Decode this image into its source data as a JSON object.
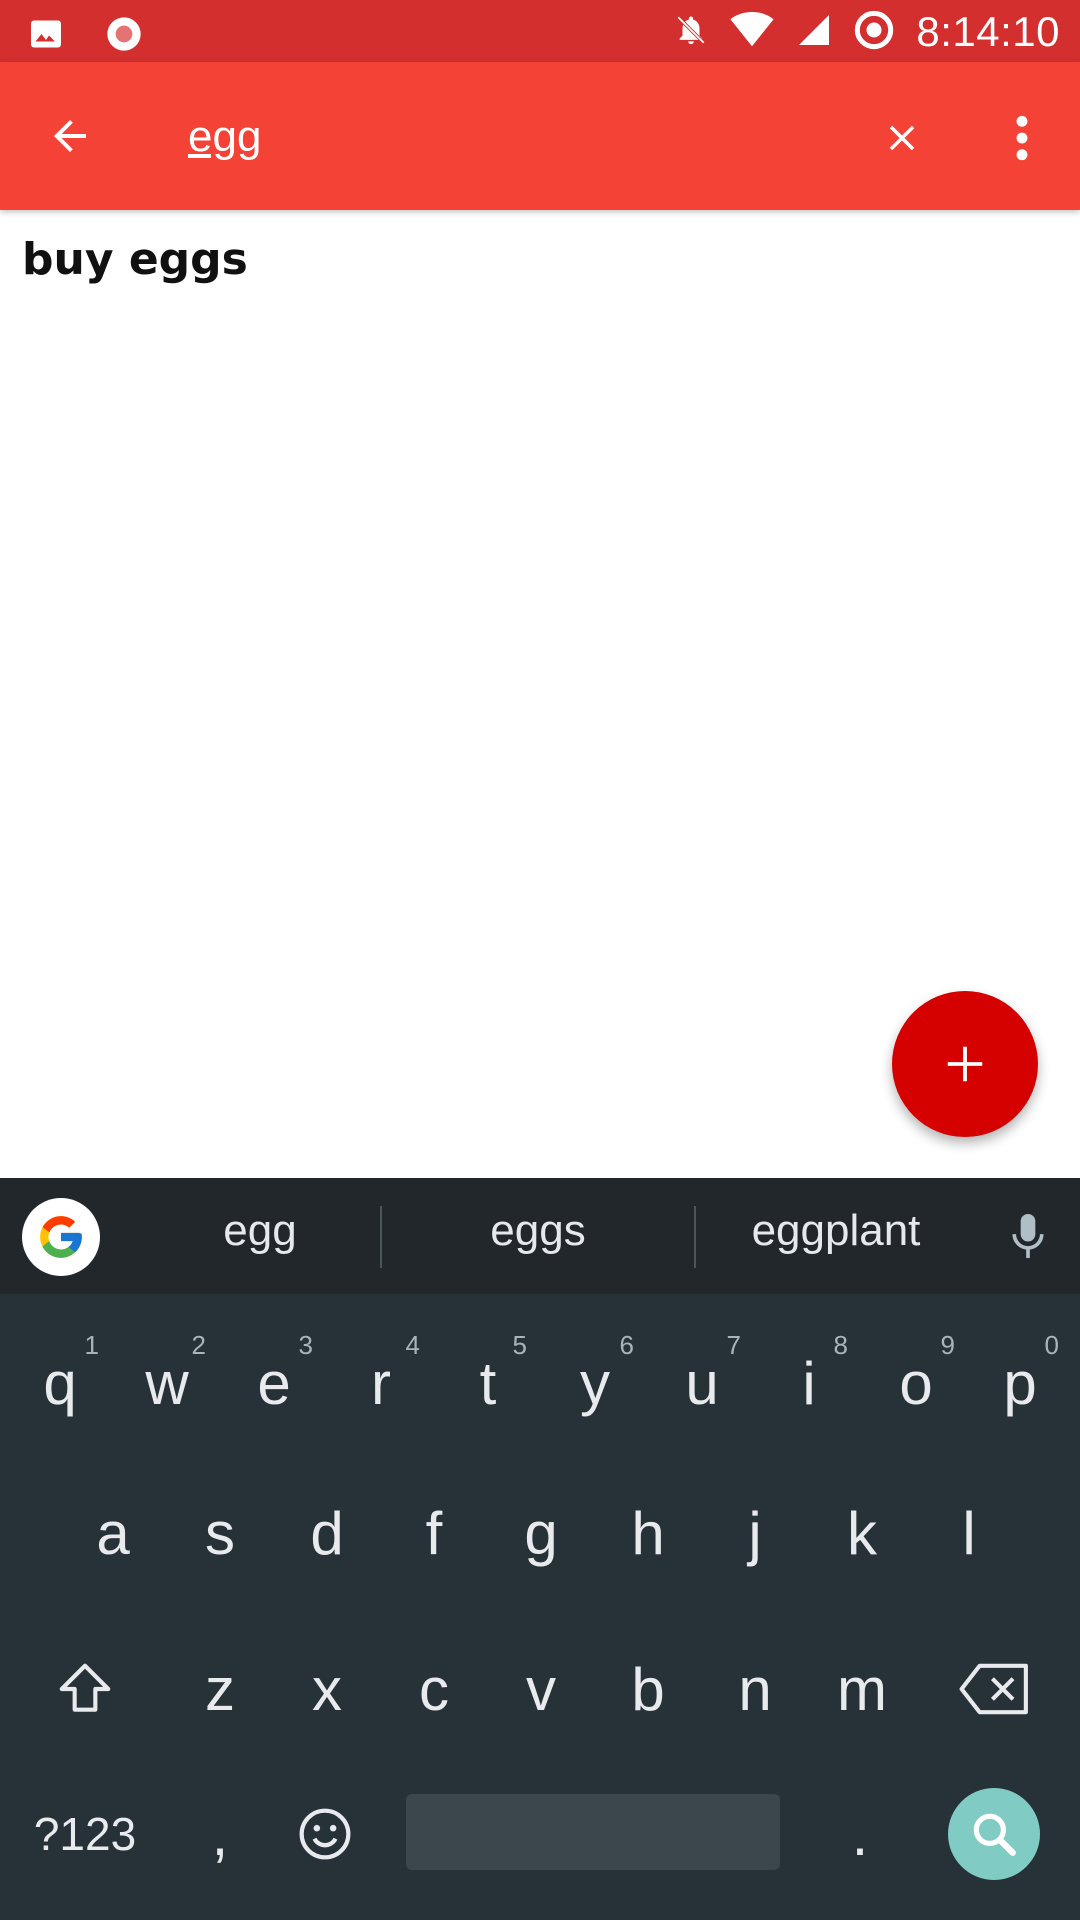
{
  "status_bar": {
    "time": "8:14:10",
    "icons": [
      "image-icon",
      "record-icon",
      "notifications-off-icon",
      "wifi-icon",
      "signal-icon",
      "sync-icon"
    ],
    "bg_color": "#d32f2f"
  },
  "app_bar": {
    "search_value": "egg",
    "bg_color": "#f44336"
  },
  "results": [
    {
      "title": "buy eggs"
    }
  ],
  "keyboard": {
    "suggestions": [
      "egg",
      "eggs",
      "eggplant"
    ],
    "row1": [
      {
        "key": "q",
        "hint": "1"
      },
      {
        "key": "w",
        "hint": "2"
      },
      {
        "key": "e",
        "hint": "3"
      },
      {
        "key": "r",
        "hint": "4"
      },
      {
        "key": "t",
        "hint": "5"
      },
      {
        "key": "y",
        "hint": "6"
      },
      {
        "key": "u",
        "hint": "7"
      },
      {
        "key": "i",
        "hint": "8"
      },
      {
        "key": "o",
        "hint": "9"
      },
      {
        "key": "p",
        "hint": "0"
      }
    ],
    "row2": [
      "a",
      "s",
      "d",
      "f",
      "g",
      "h",
      "j",
      "k",
      "l"
    ],
    "row3": [
      "z",
      "x",
      "c",
      "v",
      "b",
      "n",
      "m"
    ],
    "bottom": {
      "symbols_label": "?123",
      "comma_label": ",",
      "period_label": "."
    }
  }
}
